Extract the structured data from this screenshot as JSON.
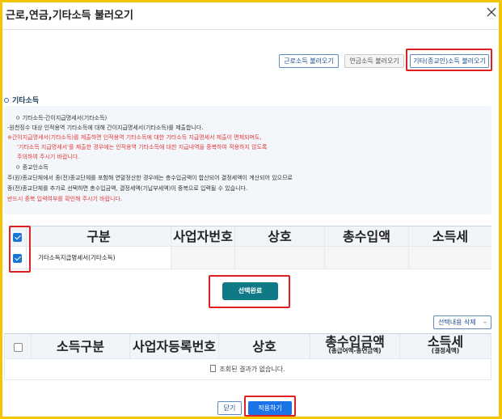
{
  "window": {
    "title": "근로,연금,기타소득 불러오기",
    "close_icon": "close-icon"
  },
  "toolbar": {
    "buttons": [
      {
        "label": "근로소득 불러오기"
      },
      {
        "label": "연금소득 불러오기"
      },
      {
        "label": "기타(종교인)소득 불러오기"
      }
    ]
  },
  "section": {
    "title": "기타소득"
  },
  "info": {
    "lines": [
      {
        "text": "ㅇ 기타소득-간이지급명세서(기타소득)",
        "color": "#333333"
      },
      {
        "text": "-원천징수 대상 인적용역 기타소득에 대해 간이지급명세서(기타소득)를 제출합니다.",
        "color": "#333333"
      },
      {
        "text": "※간이지급명세서(기타소득)를 제출하면 인적용역 기타소득에 대한 기타소득 지급명세서 제출이 면제되며도,",
        "color": "#e23a3a"
      },
      {
        "text": "'기타소득 지급명세서'를 제출한 경우에는 인적용역 기타소득에 대한 지급내역을 중복하여 적용하지 않도록",
        "color": "#e23a3a"
      },
      {
        "text": "주의하여 주시기 바랍니다.",
        "color": "#e23a3a"
      },
      {
        "text": "ㅇ 종교인소득",
        "color": "#333333"
      },
      {
        "text": "주(원)종교단체에서 종(전)종교단체를 포함해 연말정산한 경우에는 총수입금액이 합산되어 결정세액이 계산되어 있으므로",
        "color": "#333333"
      },
      {
        "text": "종(전)종교단체를 추가로 선택하면 총수입금액, 결정세액(기납부세액)이 중복으로 입력될 수 있습니다.",
        "color": "#333333"
      },
      {
        "text": "반드시 중복 입력여부를 확인해 주시기 바랍니다.",
        "color": "#e23a3a"
      }
    ]
  },
  "table1": {
    "headers": [
      "구분",
      "사업자번호",
      "상호",
      "총수입액",
      "소득세"
    ],
    "rows": [
      {
        "checked": true,
        "cells": [
          "기타소득지급명세서(기타소득)",
          "",
          "",
          "",
          ""
        ]
      }
    ],
    "header_checked": true
  },
  "complete_button": {
    "label": "선택완료"
  },
  "delete_button": {
    "label": "선택내용 삭제",
    "icon": "minus-icon"
  },
  "table2": {
    "headers": [
      {
        "line1": "소득구분",
        "line2": ""
      },
      {
        "line1": "사업자등록번호",
        "line2": ""
      },
      {
        "line1": "상호",
        "line2": ""
      },
      {
        "line1": "총수입금액",
        "line2": "(총급여액-총연금액)"
      },
      {
        "line1": "소득세",
        "line2": "(결정세액)"
      }
    ],
    "empty_message": "조회된 결과가 없습니다.",
    "empty_icon": "document-icon"
  },
  "footer": {
    "close_label": "닫기",
    "apply_label": "적용하기"
  },
  "colors": {
    "frame_border": "#f5c400",
    "highlight": "#e02020",
    "primary": "#0f7a86",
    "apply": "#1b73e8"
  }
}
